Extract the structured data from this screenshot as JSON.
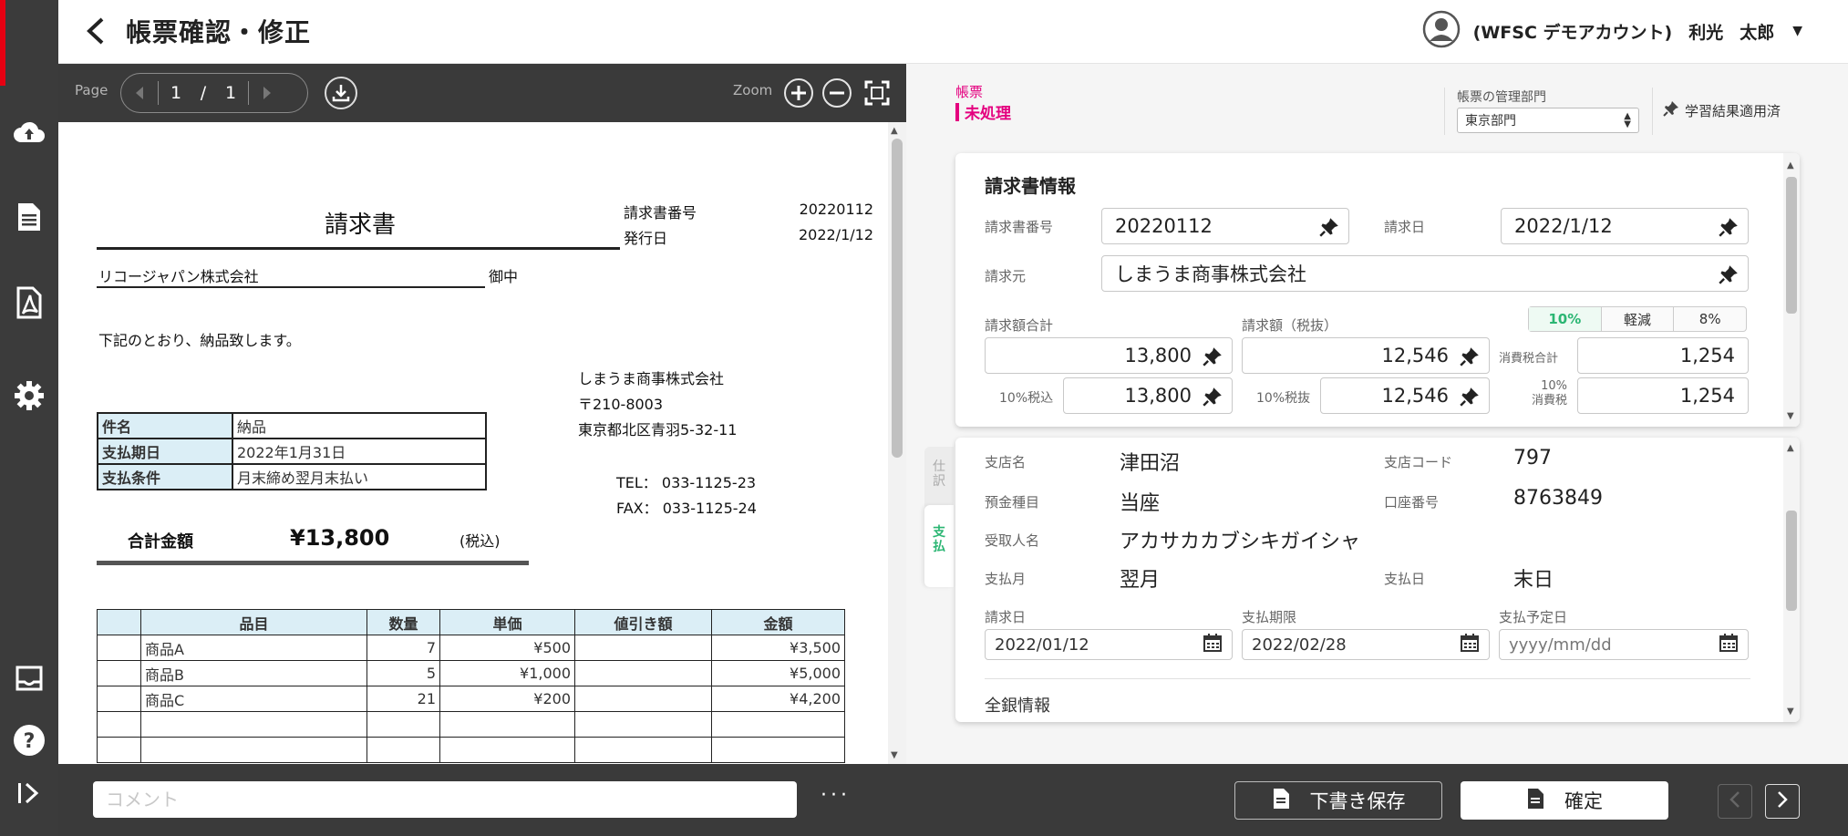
{
  "header": {
    "title": "帳票確認・修正",
    "account": "(WFSC デモアカウント)",
    "user_last": "利光",
    "user_first": "太郎"
  },
  "sidebar": {
    "items": [
      {
        "icon": "cloud-upload-icon"
      },
      {
        "icon": "document-icon"
      },
      {
        "icon": "document-pdf-icon"
      },
      {
        "icon": "gear-icon"
      },
      {
        "icon": "inbox-icon"
      },
      {
        "icon": "help-icon"
      },
      {
        "icon": "expand-icon"
      }
    ]
  },
  "viewer": {
    "page_label": "Page",
    "page_current": "1",
    "page_sep": "/",
    "page_total": "1",
    "zoom_label": "Zoom"
  },
  "document": {
    "title": "請求書",
    "invoice_no_label": "請求書番号",
    "invoice_no": "20220112",
    "issue_label": "発行日",
    "issue_date": "2022/1/12",
    "recipient": "リコージャパン株式会社",
    "honorific": "御中",
    "greeting": "下記のとおり、納品致します。",
    "issuer_name": "しまうま商事株式会社",
    "issuer_zip": "〒210-8003",
    "issuer_address": "東京都北区青羽5-32-11",
    "tel": "TEL： 033-1125-23",
    "fax": "FAX： 033-1125-24",
    "info_rows": [
      {
        "label": "件名",
        "value": "納品"
      },
      {
        "label": "支払期日",
        "value": "2022年1月31日"
      },
      {
        "label": "支払条件",
        "value": "月末締め翌月末払い"
      }
    ],
    "total_label": "合計金額",
    "total_value": "¥13,800",
    "tax_note": "(税込)",
    "item_headers": [
      "",
      "品目",
      "数量",
      "単価",
      "値引き額",
      "金額"
    ],
    "items": [
      {
        "name": "商品A",
        "qty": "7",
        "unit": "¥500",
        "discount": "",
        "amount": "¥3,500"
      },
      {
        "name": "商品B",
        "qty": "5",
        "unit": "¥1,000",
        "discount": "",
        "amount": "¥5,000"
      },
      {
        "name": "商品C",
        "qty": "21",
        "unit": "¥200",
        "discount": "",
        "amount": "¥4,200"
      },
      {
        "name": "",
        "qty": "",
        "unit": "",
        "discount": "",
        "amount": ""
      },
      {
        "name": "",
        "qty": "",
        "unit": "",
        "discount": "",
        "amount": ""
      }
    ]
  },
  "form": {
    "status_label": "帳票",
    "status_value": "未処理",
    "dept_label": "帳票の管理部門",
    "dept_value": "東京部門",
    "learning": "学習結果適用済",
    "invoice_card": {
      "title": "請求書情報",
      "invoice_no_label": "請求書番号",
      "invoice_no": "20220112",
      "invoice_date_label": "請求日",
      "invoice_date": "2022/1/12",
      "issuer_label": "請求元",
      "issuer": "しまうま商事株式会社",
      "rates": [
        "10%",
        "軽減",
        "8%"
      ],
      "total_label": "請求額合計",
      "total": "13,800",
      "net_label": "請求額（税抜）",
      "net": "12,546",
      "tax_total_label": "消費税合計",
      "tax_total": "1,254",
      "incl10_label": "10%税込",
      "incl10": "13,800",
      "excl10_label": "10%税抜",
      "excl10": "12,546",
      "tax10_label_1": "10%",
      "tax10_label_2": "消費税",
      "tax10": "1,254"
    },
    "tabs": {
      "journal": "仕訳",
      "payment": "支払"
    },
    "payment_card": {
      "branch_label": "支店名",
      "branch": "津田沼",
      "branch_code_label": "支店コード",
      "branch_code": "797",
      "account_type_label": "預金種目",
      "account_type": "当座",
      "account_no_label": "口座番号",
      "account_no": "8763849",
      "payee_label": "受取人名",
      "payee": "アカサカカブシキガイシャ",
      "pay_month_label": "支払月",
      "pay_month": "翌月",
      "pay_day_label": "支払日",
      "pay_day": "末日",
      "req_date_label": "請求日",
      "req_date": "2022/01/12",
      "deadline_label": "支払期限",
      "deadline": "2022/02/28",
      "planned_label": "支払予定日",
      "planned_placeholder": "yyyy/mm/dd",
      "zengin": "全銀情報"
    }
  },
  "footer": {
    "comment_placeholder": "コメント",
    "more": "···",
    "draft_label": "下書き保存",
    "confirm_label": "確定"
  }
}
